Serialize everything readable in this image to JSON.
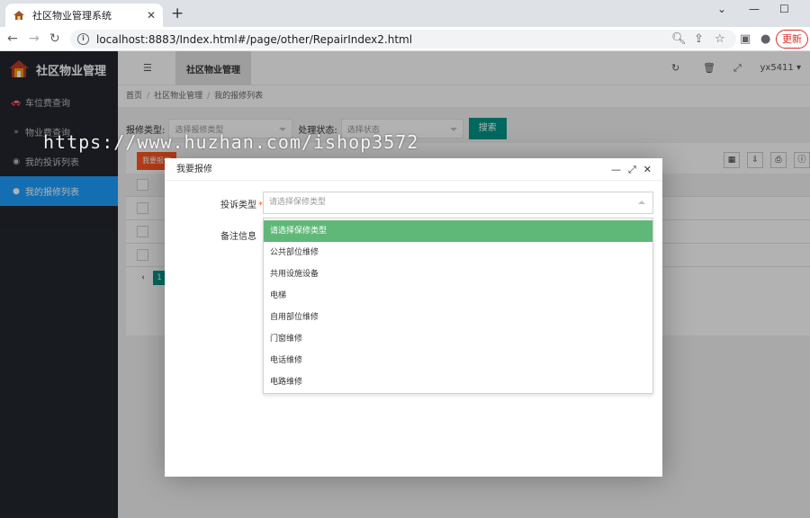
{
  "browser": {
    "tab_title": "社区物业管理系统",
    "tab_close": "✕",
    "new_tab": "+",
    "url_host": "localhost:8883",
    "url_path": "/Index.html#/page/other/RepairIndex2.html",
    "update_label": "更新"
  },
  "app": {
    "brand": "社区物业管理",
    "top_tab": "社区物业管理",
    "user": "yx5411",
    "sidebar": [
      {
        "icon": "car-icon",
        "glyph": "🚗",
        "label": "车位费查询"
      },
      {
        "icon": "chevron-icon",
        "glyph": "»",
        "label": "物业费查询"
      },
      {
        "icon": "dot-icon",
        "glyph": "◉",
        "label": "我的投诉列表"
      },
      {
        "icon": "dot-icon",
        "glyph": "●",
        "label": "我的报修列表"
      }
    ],
    "breadcrumb": {
      "home": "首页",
      "mid": "社区物业管理",
      "current": "我的报修列表",
      "sep": "/"
    },
    "filter": {
      "type_label": "报修类型:",
      "type_placeholder": "选择报修类型",
      "status_label": "处理状态:",
      "status_placeholder": "选择状态",
      "search_label": "搜索"
    },
    "table": {
      "add_label": "我要报修",
      "page_prev": "‹",
      "page_current": "1"
    }
  },
  "dialog": {
    "title": "我要报修",
    "type_label": "投诉类型",
    "required_mark": "*",
    "type_placeholder": "请选择保修类型",
    "remark_label": "备注信息",
    "options": [
      "请选择保修类型",
      "公共部位维修",
      "共用设施设备",
      "电梯",
      "自用部位维修",
      "门窗维修",
      "电话维修",
      "电路维修"
    ]
  },
  "watermark": "https://www.huzhan.com/ishop3572",
  "colors": {
    "sidebar_bg": "#23262e",
    "sidebar_active": "#1e9fff",
    "primary_green": "#009688",
    "option_selected": "#5fb878",
    "danger": "#ff5722"
  }
}
